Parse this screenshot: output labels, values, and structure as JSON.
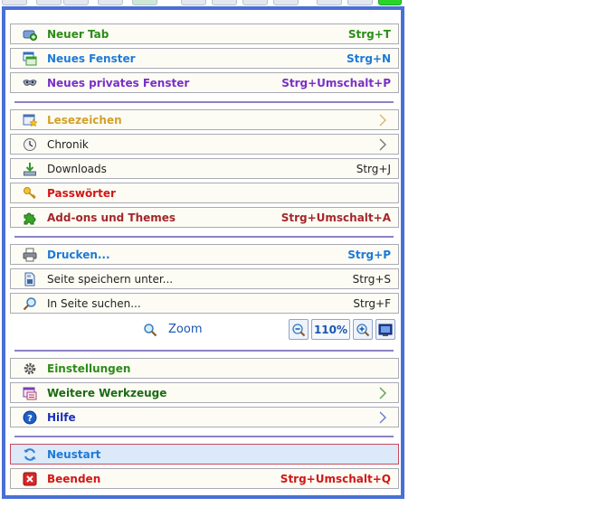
{
  "colors": {
    "panel_border": "#4a6fd6",
    "separator": "#8d82c1",
    "green": "#2e8b1a",
    "blue": "#1e7ad6",
    "purple": "#7a2fc8",
    "gold": "#d2a12a",
    "red": "#d31616",
    "darkred": "#a3282a",
    "darkgreen": "#1a6b12",
    "navy": "#1a2fb8",
    "text": "#222222"
  },
  "menu": {
    "new_tab": {
      "label": "Neuer Tab",
      "shortcut": "Strg+T",
      "icon": "new-tab-icon"
    },
    "new_window": {
      "label": "Neues Fenster",
      "shortcut": "Strg+N",
      "icon": "window-icon"
    },
    "private_window": {
      "label": "Neues privates Fenster",
      "shortcut": "Strg+Umschalt+P",
      "icon": "mask-icon"
    },
    "bookmarks": {
      "label": "Lesezeichen",
      "icon": "bookmark-star-icon"
    },
    "history": {
      "label": "Chronik",
      "icon": "clock-icon"
    },
    "downloads": {
      "label": "Downloads",
      "shortcut": "Strg+J",
      "icon": "download-icon"
    },
    "passwords": {
      "label": "Passwörter",
      "icon": "key-icon"
    },
    "addons": {
      "label": "Add-ons und Themes",
      "shortcut": "Strg+Umschalt+A",
      "icon": "puzzle-icon"
    },
    "print": {
      "label": "Drucken...",
      "shortcut": "Strg+P",
      "icon": "printer-icon"
    },
    "save_page": {
      "label": "Seite speichern unter...",
      "shortcut": "Strg+S",
      "icon": "save-page-icon"
    },
    "find": {
      "label": "In Seite suchen...",
      "shortcut": "Strg+F",
      "icon": "magnifier-icon"
    },
    "zoom": {
      "label": "Zoom",
      "level": "110%",
      "icon": "zoom-icon"
    },
    "settings": {
      "label": "Einstellungen",
      "icon": "gear-icon"
    },
    "more_tools": {
      "label": "Weitere Werkzeuge",
      "icon": "tools-icon"
    },
    "help": {
      "label": "Hilfe",
      "icon": "help-icon"
    },
    "restart": {
      "label": "Neustart",
      "icon": "restart-icon"
    },
    "quit": {
      "label": "Beenden",
      "shortcut": "Strg+Umschalt+Q",
      "icon": "close-icon"
    }
  }
}
